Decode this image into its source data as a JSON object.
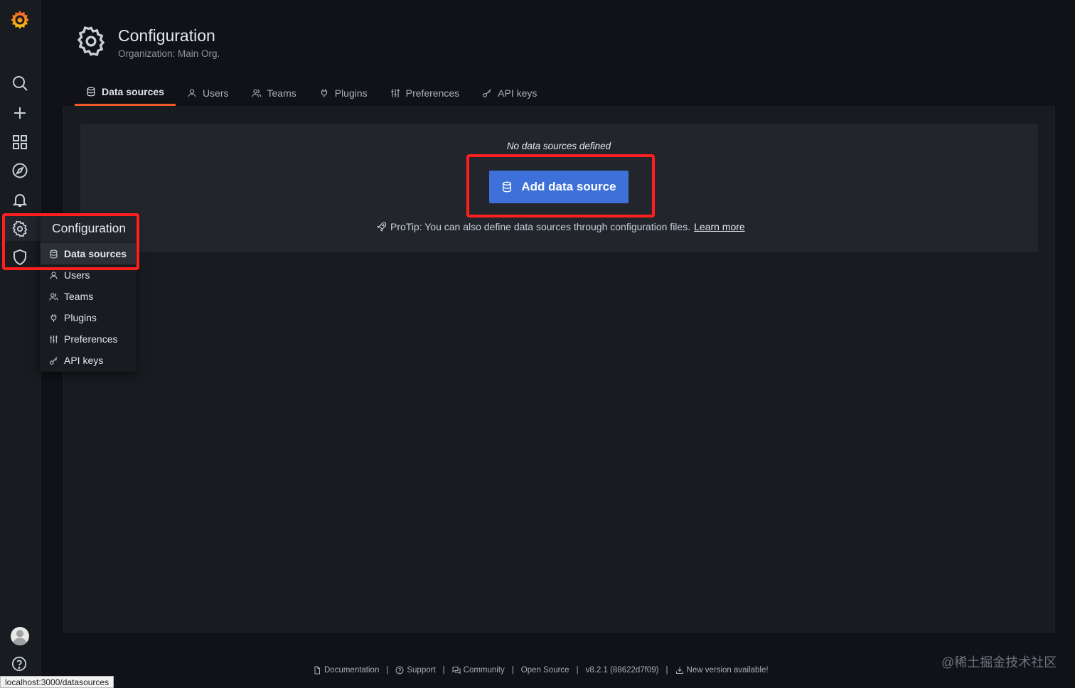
{
  "colors": {
    "background": "#111217",
    "panel": "#181b1f",
    "primary_button": "#3d71d9",
    "active_tab_underline": "#f05a28",
    "highlight_box": "#ff1f1f"
  },
  "sidebar": {
    "icons": [
      "grafana-logo-icon",
      "search-icon",
      "plus-icon",
      "dashboards-icon",
      "explore-icon",
      "alerting-icon",
      "gear-icon",
      "shield-icon",
      "avatar",
      "help-icon"
    ]
  },
  "header": {
    "icon": "gear-icon",
    "title": "Configuration",
    "subtitle": "Organization: Main Org."
  },
  "tabs": [
    {
      "label": "Data sources",
      "icon": "database-icon",
      "active": true
    },
    {
      "label": "Users",
      "icon": "user-icon"
    },
    {
      "label": "Teams",
      "icon": "users-icon"
    },
    {
      "label": "Plugins",
      "icon": "plug-icon"
    },
    {
      "label": "Preferences",
      "icon": "sliders-icon"
    },
    {
      "label": "API keys",
      "icon": "key-icon"
    }
  ],
  "empty_state": {
    "title": "No data sources defined",
    "button_label": "Add data source",
    "protip": "ProTip: You can also define data sources through configuration files.",
    "learn_more": "Learn more"
  },
  "flyout": {
    "title": "Configuration",
    "items": [
      {
        "label": "Data sources",
        "icon": "database-icon",
        "active": true
      },
      {
        "label": "Users",
        "icon": "user-icon"
      },
      {
        "label": "Teams",
        "icon": "users-icon"
      },
      {
        "label": "Plugins",
        "icon": "plug-icon"
      },
      {
        "label": "Preferences",
        "icon": "sliders-icon"
      },
      {
        "label": "API keys",
        "icon": "key-icon"
      }
    ]
  },
  "footer": {
    "documentation": "Documentation",
    "support": "Support",
    "community": "Community",
    "open_source": "Open Source",
    "version": "v8.2.1 (88622d7f09)",
    "new_version": "New version available!"
  },
  "watermark": "@稀土掘金技术社区",
  "status_url": "localhost:3000/datasources"
}
